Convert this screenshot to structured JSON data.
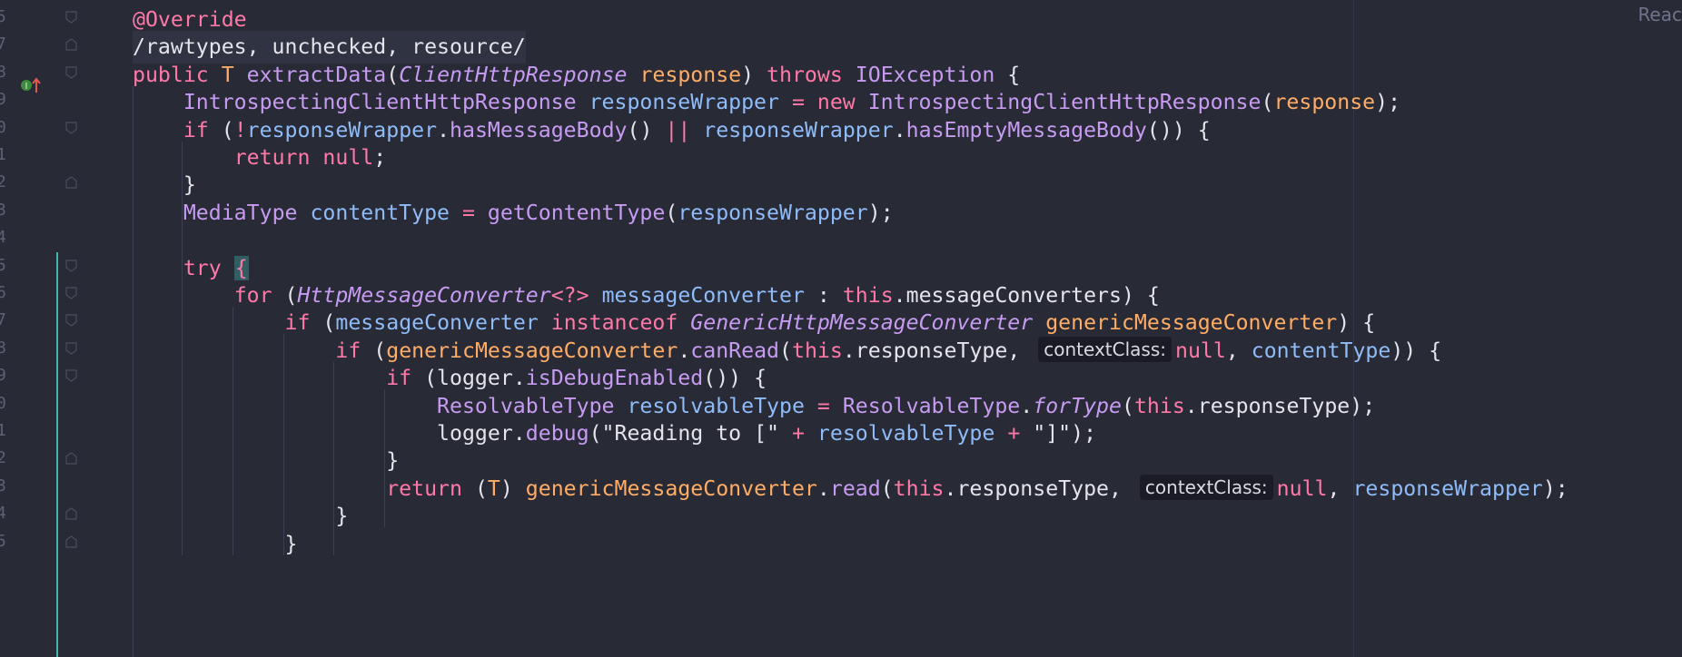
{
  "editor": {
    "reader_mode_label": "Reac",
    "line_numbers": [
      "5",
      "7",
      "8",
      "9",
      "0",
      "1",
      "2",
      "3",
      "4",
      "5",
      "6",
      "7",
      "8",
      "9",
      "0",
      "1",
      "2",
      "3",
      "4",
      "5"
    ],
    "lines": [
      {
        "tokens": [
          {
            "t": "@Override",
            "c": "ann"
          }
        ]
      },
      {
        "tokens": [
          {
            "t": "/rawtypes, unchecked, resource/",
            "c": "plain"
          }
        ]
      },
      {
        "tokens": [
          {
            "t": "public ",
            "c": "kw"
          },
          {
            "t": "T ",
            "c": "param"
          },
          {
            "t": "extractData",
            "c": "fn"
          },
          {
            "t": "(",
            "c": "pun"
          },
          {
            "t": "ClientHttpResponse",
            "c": "ityp"
          },
          {
            "t": " ",
            "c": "pun"
          },
          {
            "t": "response",
            "c": "param"
          },
          {
            "t": ") ",
            "c": "pun"
          },
          {
            "t": "throws ",
            "c": "kw"
          },
          {
            "t": "IOException",
            "c": "type"
          },
          {
            "t": " {",
            "c": "pun"
          }
        ]
      },
      {
        "tokens": [
          {
            "t": "    ",
            "c": "pun"
          },
          {
            "t": "IntrospectingClientHttpResponse",
            "c": "type"
          },
          {
            "t": " ",
            "c": "pun"
          },
          {
            "t": "responseWrapper",
            "c": "var"
          },
          {
            "t": " = ",
            "c": "op"
          },
          {
            "t": "new ",
            "c": "kw"
          },
          {
            "t": "IntrospectingClientHttpResponse",
            "c": "type"
          },
          {
            "t": "(",
            "c": "pun"
          },
          {
            "t": "response",
            "c": "param"
          },
          {
            "t": ");",
            "c": "pun"
          }
        ]
      },
      {
        "tokens": [
          {
            "t": "    ",
            "c": "pun"
          },
          {
            "t": "if ",
            "c": "kw"
          },
          {
            "t": "(",
            "c": "pun"
          },
          {
            "t": "!",
            "c": "op"
          },
          {
            "t": "responseWrapper",
            "c": "var"
          },
          {
            "t": ".",
            "c": "pun"
          },
          {
            "t": "hasMessageBody",
            "c": "fn"
          },
          {
            "t": "() ",
            "c": "pun"
          },
          {
            "t": "||",
            "c": "op"
          },
          {
            "t": " ",
            "c": "pun"
          },
          {
            "t": "responseWrapper",
            "c": "var"
          },
          {
            "t": ".",
            "c": "pun"
          },
          {
            "t": "hasEmptyMessageBody",
            "c": "fn"
          },
          {
            "t": "()) {",
            "c": "pun"
          }
        ]
      },
      {
        "tokens": [
          {
            "t": "        ",
            "c": "pun"
          },
          {
            "t": "return ",
            "c": "kw"
          },
          {
            "t": "null",
            "c": "kw"
          },
          {
            "t": ";",
            "c": "pun"
          }
        ]
      },
      {
        "tokens": [
          {
            "t": "    }",
            "c": "pun"
          }
        ]
      },
      {
        "tokens": [
          {
            "t": "    ",
            "c": "pun"
          },
          {
            "t": "MediaType",
            "c": "type"
          },
          {
            "t": " ",
            "c": "pun"
          },
          {
            "t": "contentType",
            "c": "var"
          },
          {
            "t": " = ",
            "c": "op"
          },
          {
            "t": "getContentType",
            "c": "fn"
          },
          {
            "t": "(",
            "c": "pun"
          },
          {
            "t": "responseWrapper",
            "c": "var"
          },
          {
            "t": ");",
            "c": "pun"
          }
        ]
      },
      {
        "tokens": []
      },
      {
        "tokens": [
          {
            "t": "    ",
            "c": "pun"
          },
          {
            "t": "try ",
            "c": "kw"
          },
          {
            "t": "{",
            "c": "caret"
          }
        ]
      },
      {
        "tokens": [
          {
            "t": "        ",
            "c": "pun"
          },
          {
            "t": "for ",
            "c": "kw"
          },
          {
            "t": "(",
            "c": "pun"
          },
          {
            "t": "HttpMessageConverter",
            "c": "ityp"
          },
          {
            "t": "<?>",
            "c": "op"
          },
          {
            "t": " ",
            "c": "pun"
          },
          {
            "t": "messageConverter",
            "c": "var"
          },
          {
            "t": " : ",
            "c": "pun"
          },
          {
            "t": "this",
            "c": "kw"
          },
          {
            "t": ".messageConverters) {",
            "c": "pun"
          }
        ]
      },
      {
        "tokens": [
          {
            "t": "            ",
            "c": "pun"
          },
          {
            "t": "if ",
            "c": "kw"
          },
          {
            "t": "(",
            "c": "pun"
          },
          {
            "t": "messageConverter",
            "c": "var"
          },
          {
            "t": " ",
            "c": "pun"
          },
          {
            "t": "instanceof ",
            "c": "kw"
          },
          {
            "t": "GenericHttpMessageConverter",
            "c": "ityp"
          },
          {
            "t": " ",
            "c": "pun"
          },
          {
            "t": "genericMessageConverter",
            "c": "param"
          },
          {
            "t": ") {",
            "c": "pun"
          }
        ]
      },
      {
        "tokens": [
          {
            "t": "                ",
            "c": "pun"
          },
          {
            "t": "if ",
            "c": "kw"
          },
          {
            "t": "(",
            "c": "pun"
          },
          {
            "t": "genericMessageConverter",
            "c": "param"
          },
          {
            "t": ".",
            "c": "pun"
          },
          {
            "t": "canRead",
            "c": "fn"
          },
          {
            "t": "(",
            "c": "pun"
          },
          {
            "t": "this",
            "c": "kw"
          },
          {
            "t": ".responseType, ",
            "c": "pun"
          },
          {
            "t": "contextClass:",
            "c": "hint"
          },
          {
            "t": "null",
            "c": "kw"
          },
          {
            "t": ", ",
            "c": "pun"
          },
          {
            "t": "contentType",
            "c": "var"
          },
          {
            "t": ")) {",
            "c": "pun"
          }
        ]
      },
      {
        "tokens": [
          {
            "t": "                    ",
            "c": "pun"
          },
          {
            "t": "if ",
            "c": "kw"
          },
          {
            "t": "(logger.",
            "c": "pun"
          },
          {
            "t": "isDebugEnabled",
            "c": "fn"
          },
          {
            "t": "()) {",
            "c": "pun"
          }
        ]
      },
      {
        "tokens": [
          {
            "t": "                        ",
            "c": "pun"
          },
          {
            "t": "ResolvableType",
            "c": "type"
          },
          {
            "t": " ",
            "c": "pun"
          },
          {
            "t": "resolvableType",
            "c": "var"
          },
          {
            "t": " = ",
            "c": "op"
          },
          {
            "t": "ResolvableType",
            "c": "type"
          },
          {
            "t": ".",
            "c": "pun"
          },
          {
            "t": "forType",
            "c": "ifn"
          },
          {
            "t": "(",
            "c": "pun"
          },
          {
            "t": "this",
            "c": "kw"
          },
          {
            "t": ".responseType);",
            "c": "pun"
          }
        ]
      },
      {
        "tokens": [
          {
            "t": "                        ",
            "c": "pun"
          },
          {
            "t": "logger.",
            "c": "pun"
          },
          {
            "t": "debug",
            "c": "fn"
          },
          {
            "t": "(\"Reading to [\" ",
            "c": "str"
          },
          {
            "t": "+",
            "c": "op"
          },
          {
            "t": " ",
            "c": "pun"
          },
          {
            "t": "resolvableType",
            "c": "var"
          },
          {
            "t": " ",
            "c": "pun"
          },
          {
            "t": "+",
            "c": "op"
          },
          {
            "t": " \"]\");",
            "c": "str"
          }
        ]
      },
      {
        "tokens": [
          {
            "t": "                    }",
            "c": "pun"
          }
        ]
      },
      {
        "tokens": [
          {
            "t": "                    ",
            "c": "pun"
          },
          {
            "t": "return ",
            "c": "kw"
          },
          {
            "t": "(",
            "c": "pun"
          },
          {
            "t": "T",
            "c": "param"
          },
          {
            "t": ") ",
            "c": "pun"
          },
          {
            "t": "genericMessageConverter",
            "c": "param"
          },
          {
            "t": ".",
            "c": "pun"
          },
          {
            "t": "read",
            "c": "fn"
          },
          {
            "t": "(",
            "c": "pun"
          },
          {
            "t": "this",
            "c": "kw"
          },
          {
            "t": ".responseType, ",
            "c": "pun"
          },
          {
            "t": "contextClass:",
            "c": "hint"
          },
          {
            "t": "null",
            "c": "kw"
          },
          {
            "t": ", ",
            "c": "pun"
          },
          {
            "t": "responseWrapper",
            "c": "var"
          },
          {
            "t": ");",
            "c": "pun"
          }
        ]
      },
      {
        "tokens": [
          {
            "t": "                }",
            "c": "pun"
          }
        ]
      },
      {
        "tokens": [
          {
            "t": "            }",
            "c": "pun"
          }
        ]
      }
    ]
  }
}
